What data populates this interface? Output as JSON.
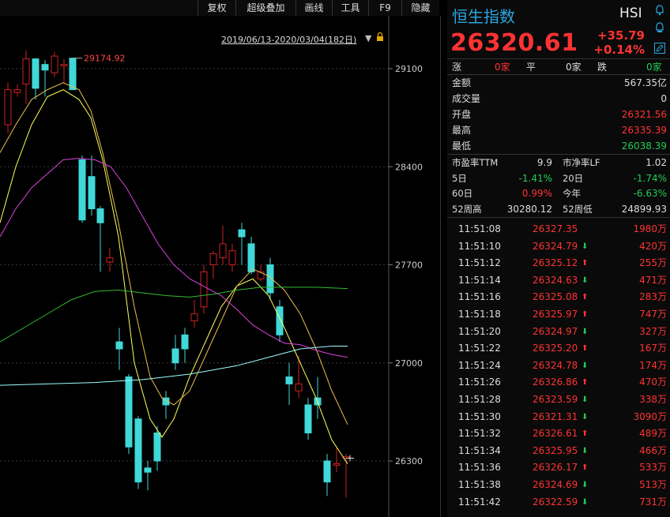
{
  "toolbar": {
    "items": [
      "复权",
      "超级叠加",
      "画线",
      "工具",
      "F9",
      "隐藏"
    ]
  },
  "chart": {
    "date_range": "2019/06/13-2020/03/04(182日)",
    "peak_label": "29174.92",
    "y_ticks": [
      "29100",
      "28400",
      "27700",
      "27000",
      "26300"
    ]
  },
  "header": {
    "name": "恒生指数",
    "code": "HSI",
    "price": "26320.61",
    "change": "+35.79",
    "change_pct": "+0.14%"
  },
  "breadth": {
    "up_label": "涨",
    "up_value": "0家",
    "flat_label": "平",
    "flat_value": "0家",
    "down_label": "跌",
    "down_value": "0家"
  },
  "stats": [
    {
      "label": "金额",
      "value": "567.35亿",
      "color": "white"
    },
    {
      "label": "成交量",
      "value": "0",
      "color": "white"
    },
    {
      "label": "开盘",
      "value": "26321.56",
      "color": "red"
    },
    {
      "label": "最高",
      "value": "26335.39",
      "color": "red"
    },
    {
      "label": "最低",
      "value": "26038.39",
      "color": "green"
    }
  ],
  "ratios": [
    {
      "l1": "市盈率TTM",
      "v1": "9.9",
      "c1": "white",
      "l2": "市净率LF",
      "v2": "1.02",
      "c2": "white"
    },
    {
      "l1": "5日",
      "v1": "-1.41%",
      "c1": "green",
      "l2": "20日",
      "v2": "-1.74%",
      "c2": "green"
    },
    {
      "l1": "60日",
      "v1": "0.99%",
      "c1": "red",
      "l2": "今年",
      "v2": "-6.63%",
      "c2": "green"
    },
    {
      "l1": "52周高",
      "v1": "30280.12",
      "c1": "white",
      "l2": "52周低",
      "v2": "24899.93",
      "c2": "white"
    }
  ],
  "ticks": [
    {
      "time": "11:51:08",
      "price": "26327.35",
      "dir": "",
      "vol": "1980万"
    },
    {
      "time": "11:51:10",
      "price": "26324.79",
      "dir": "down",
      "vol": "420万"
    },
    {
      "time": "11:51:12",
      "price": "26325.12",
      "dir": "up",
      "vol": "255万"
    },
    {
      "time": "11:51:14",
      "price": "26324.63",
      "dir": "down",
      "vol": "471万"
    },
    {
      "time": "11:51:16",
      "price": "26325.08",
      "dir": "up",
      "vol": "283万"
    },
    {
      "time": "11:51:18",
      "price": "26325.97",
      "dir": "up",
      "vol": "747万"
    },
    {
      "time": "11:51:20",
      "price": "26324.97",
      "dir": "down",
      "vol": "327万"
    },
    {
      "time": "11:51:22",
      "price": "26325.20",
      "dir": "up",
      "vol": "167万"
    },
    {
      "time": "11:51:24",
      "price": "26324.78",
      "dir": "down",
      "vol": "174万"
    },
    {
      "time": "11:51:26",
      "price": "26326.86",
      "dir": "up",
      "vol": "470万"
    },
    {
      "time": "11:51:28",
      "price": "26323.59",
      "dir": "down",
      "vol": "338万"
    },
    {
      "time": "11:51:30",
      "price": "26321.31",
      "dir": "down",
      "vol": "3090万"
    },
    {
      "time": "11:51:32",
      "price": "26326.61",
      "dir": "up",
      "vol": "489万"
    },
    {
      "time": "11:51:34",
      "price": "26325.95",
      "dir": "down",
      "vol": "466万"
    },
    {
      "time": "11:51:36",
      "price": "26326.17",
      "dir": "up",
      "vol": "533万"
    },
    {
      "time": "11:51:38",
      "price": "26324.69",
      "dir": "down",
      "vol": "513万"
    },
    {
      "time": "11:51:42",
      "price": "26322.59",
      "dir": "down",
      "vol": "731万"
    }
  ],
  "colors": {
    "up": "#ff3333",
    "down": "#22cc55",
    "accent": "#2aa6e0",
    "bull_candle": "#40d8d8",
    "bear_candle": "#cc2222"
  }
}
